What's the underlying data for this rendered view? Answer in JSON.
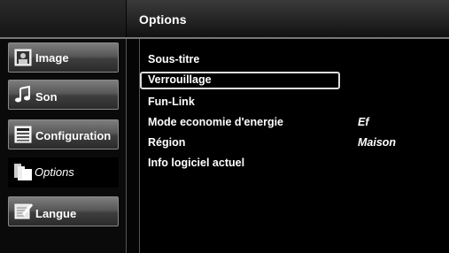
{
  "header": {
    "title": "Options"
  },
  "sidebar": {
    "items": [
      {
        "label": "Image",
        "icon": "image-icon",
        "active": false
      },
      {
        "label": "Son",
        "icon": "music-note-icon",
        "active": false
      },
      {
        "label": "Configuration",
        "icon": "settings-list-icon",
        "active": false
      },
      {
        "label": "Options",
        "icon": "options-cards-icon",
        "active": true
      },
      {
        "label": "Langue",
        "icon": "language-pencil-icon",
        "active": false
      }
    ]
  },
  "main": {
    "items": [
      {
        "label": "Sous-titre",
        "value": "",
        "selected": false
      },
      {
        "label": "Verrouillage",
        "value": "",
        "selected": true
      },
      {
        "label": "Fun-Link",
        "value": "",
        "selected": false
      },
      {
        "label": "Mode economie d'energie",
        "value": "Ef",
        "selected": false
      },
      {
        "label": "Région",
        "value": "Maison",
        "selected": false
      },
      {
        "label": "Info logiciel actuel",
        "value": "",
        "selected": false
      }
    ]
  }
}
